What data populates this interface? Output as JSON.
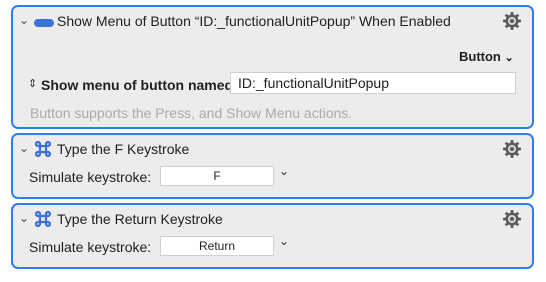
{
  "actions": [
    {
      "title": "Show Menu of Button “ID:_functionalUnitPopup” When Enabled",
      "type_label": "Button",
      "field_label": "Show menu of button named:",
      "field_value": "ID:_functionalUnitPopup",
      "help_text": "Button supports the Press, and Show Menu actions."
    },
    {
      "title": "Type the F Keystroke",
      "field_label": "Simulate keystroke:",
      "keystroke": "F"
    },
    {
      "title": "Type the Return Keystroke",
      "field_label": "Simulate keystroke:",
      "keystroke": "Return"
    }
  ],
  "icons": {
    "collapse": "chevron-down-icon",
    "action_button": "button-icon",
    "keystroke": "command-key-icon",
    "gear": "gear-icon",
    "accent": "#2f7ef0"
  }
}
